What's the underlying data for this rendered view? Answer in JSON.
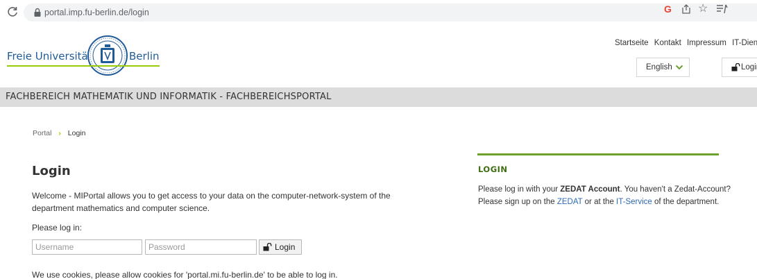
{
  "browser": {
    "url": "portal.imp.fu-berlin.de/login",
    "g_letter": "G",
    "star": "☆"
  },
  "header": {
    "logo": {
      "left_text": "Freie Universität",
      "right_text": "Berlin"
    },
    "links": [
      "Startseite",
      "Kontakt",
      "Impressum",
      "IT-Diens"
    ],
    "language": "English",
    "login_label": "Login",
    "department": "FACHBEREICH MATHEMATIK UND INFORMATIK - FACHBEREICHSPORTAL"
  },
  "breadcrumb": {
    "items": [
      "Portal",
      "Login"
    ],
    "separator": "›"
  },
  "main": {
    "title": "Login",
    "welcome": "Welcome - MIPortal allows you to get access to your data on the computer-network-system of the department mathematics and computer science.",
    "prompt": "Please log in:",
    "username_placeholder": "Username",
    "password_placeholder": "Password",
    "login_button": "Login",
    "cookie_note": "We use cookies, please allow cookies for 'portal.mi.fu-berlin.de' to be able to log in."
  },
  "sidebar": {
    "title": "LOGIN",
    "text_1": "Please log in with your ",
    "bold": "ZEDAT Account",
    "text_2": ". You haven't a Zedat-Account? Please sign up on the ",
    "link_zedat": "ZEDAT",
    "text_3": " or at the ",
    "link_it": "IT-Service",
    "text_4": " of the department."
  },
  "colors": {
    "accent_green": "#99cc00",
    "sidebar_green": "#6ba12a",
    "link_blue": "#2d6ab5",
    "fu_blue": "#1f5a99"
  }
}
